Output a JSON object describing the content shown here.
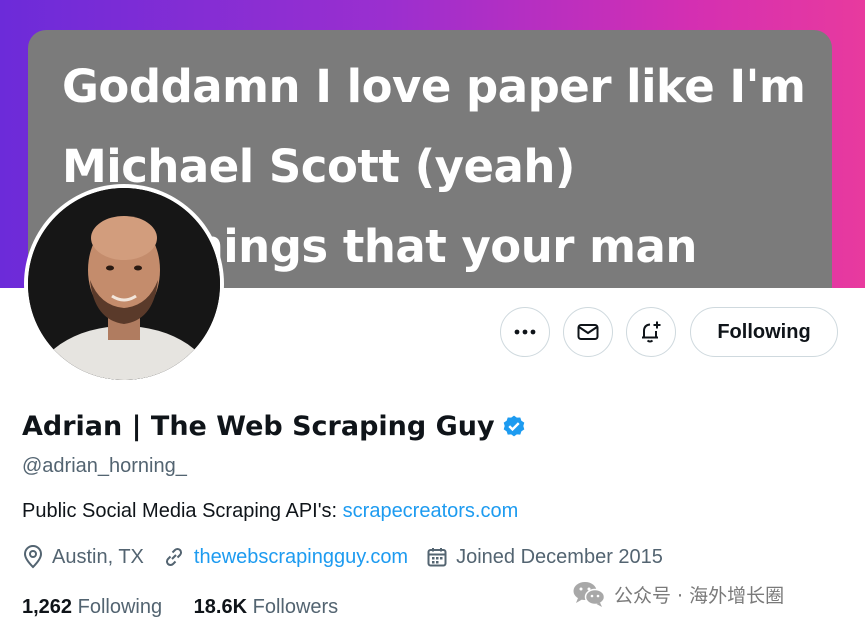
{
  "banner": {
    "lines": [
      "Goddamn I love paper like I'm",
      "Michael Scott (yeah)",
      "I do things that your man"
    ]
  },
  "profile": {
    "display_name": "Adrian | The Web Scraping Guy",
    "handle": "@adrian_horning_",
    "bio_text": "Public Social Media Scraping API's: ",
    "bio_link": "scrapecreators.com",
    "location": "Austin, TX",
    "website": "thewebscrapingguy.com",
    "joined": "Joined December 2015",
    "following_count": "1,262",
    "following_label": "Following",
    "followers_count": "18.6K",
    "followers_label": "Followers"
  },
  "actions": {
    "follow_button": "Following"
  },
  "watermark": {
    "text": "公众号 · 海外增长圈"
  },
  "icons": [
    "more-icon",
    "mail-icon",
    "notification-bell-plus-icon",
    "verified-badge-icon",
    "location-pin-icon",
    "link-icon",
    "calendar-icon",
    "wechat-icon"
  ],
  "colors": {
    "link": "#1d9bf0",
    "verified": "#1d9bf0",
    "secondary_text": "#536471",
    "banner_gradient_start": "#6c2bd9",
    "banner_gradient_end": "#e83a9e"
  }
}
